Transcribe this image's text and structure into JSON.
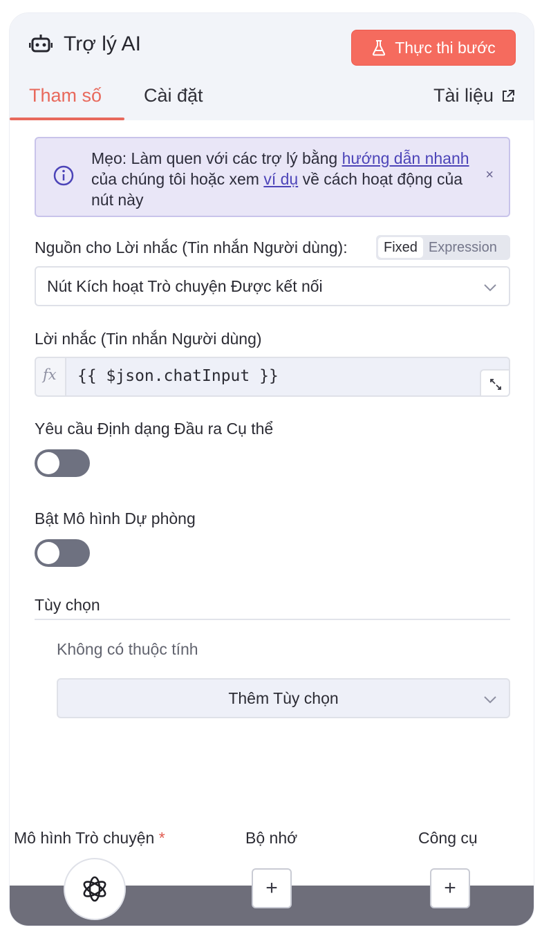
{
  "header": {
    "title": "Trợ lý AI",
    "run_button_label": "Thực thi bước",
    "tabs": [
      {
        "label": "Tham số",
        "active": true
      },
      {
        "label": "Cài đặt",
        "active": false
      }
    ],
    "docs_label": "Tài liệu"
  },
  "tip": {
    "prefix": "Mẹo: Làm quen với các trợ lý bằng ",
    "link1": "hướng dẫn nhanh",
    "middle": " của chúng tôi hoặc xem ",
    "link2": "ví dụ",
    "suffix": " về cách hoạt động của nút này",
    "close": "×"
  },
  "prompt_source": {
    "label": "Nguồn cho Lời nhắc (Tin nhắn Người dùng)",
    "mode_fixed": "Fixed",
    "mode_expression": "Expression",
    "value": "Nút Kích hoạt Trò chuyện Được kết nối"
  },
  "prompt": {
    "label": "Lời nhắc (Tin nhắn Người dùng)",
    "fx": "fx",
    "value": "{{ $json.chatInput }}"
  },
  "output_format": {
    "label": "Yêu cầu Định dạng Đầu ra Cụ thể",
    "enabled": false
  },
  "fallback_model": {
    "label": "Bật Mô hình Dự phòng",
    "enabled": false
  },
  "options": {
    "label": "Tùy chọn",
    "empty_text": "Không có thuộc tính",
    "add_label": "Thêm Tùy chọn"
  },
  "subnodes": {
    "chat_model": "Mô hình Trò chuyện",
    "required_mark": "*",
    "memory": "Bộ nhớ",
    "tools": "Công cụ",
    "plus": "+"
  },
  "colors": {
    "accent": "#f56b5e",
    "tip_bg": "#e9e6f7",
    "link": "#4c44b8",
    "switch_off": "#6e7180"
  }
}
